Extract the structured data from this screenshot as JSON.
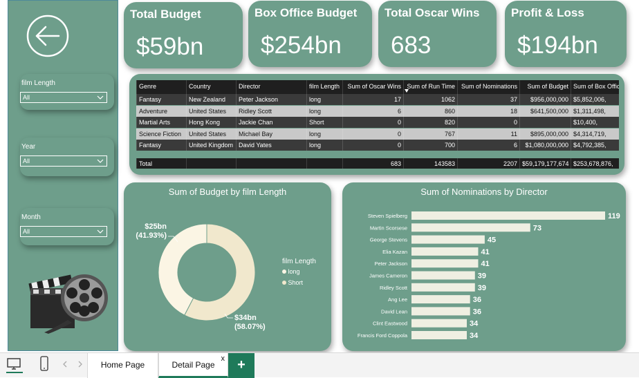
{
  "kpis": [
    {
      "title": "Total Budget",
      "value": "$59bn"
    },
    {
      "title": "Box Office Budget",
      "value": "$254bn"
    },
    {
      "title": "Total Oscar Wins",
      "value": "683"
    },
    {
      "title": "Profit & Loss",
      "value": "$194bn"
    }
  ],
  "slicers": [
    {
      "title": "film Length",
      "value": "All"
    },
    {
      "title": "Year",
      "value": "All"
    },
    {
      "title": "Month",
      "value": "All"
    }
  ],
  "table": {
    "headers": [
      "Genre",
      "Country",
      "Director",
      "film Length",
      "Sum of Oscar Wins",
      "Sum of Run Time",
      "Sum of Nominations",
      "Sum of Budget",
      "Sum of Box Office"
    ],
    "rows": [
      [
        "Fantasy",
        "New Zealand",
        "Peter Jackson",
        "long",
        "17",
        "1062",
        "37",
        "$956,000,000",
        "$5,852,006,"
      ],
      [
        "Adventure",
        "United States",
        "Ridley Scott",
        "long",
        "6",
        "860",
        "18",
        "$641,500,000",
        "$1,311,498,"
      ],
      [
        "Martial Arts",
        "Hong Kong",
        "Jackie Chan",
        "Short",
        "0",
        "820",
        "0",
        "",
        "$10,400,"
      ],
      [
        "Science Fiction",
        "United States",
        "Michael Bay",
        "long",
        "0",
        "767",
        "11",
        "$895,000,000",
        "$4,314,719,"
      ],
      [
        "Fantasy",
        "United Kingdom",
        "David Yates",
        "long",
        "0",
        "700",
        "6",
        "$1,080,000,000",
        "$4,792,385,"
      ]
    ],
    "total": [
      "Total",
      "",
      "",
      "",
      "683",
      "143583",
      "2207",
      "$59,179,177,674",
      "$253,678,876,"
    ]
  },
  "donut": {
    "title": "Sum of Budget by film Length",
    "legend_title": "film Length",
    "label_long_value": "$25bn",
    "label_long_pct": "(41.93%)",
    "label_short_value": "$34bn",
    "label_short_pct": "(58.07%)"
  },
  "bar_title": "Sum of Nominations by Director",
  "chart_data": [
    {
      "type": "pie",
      "title": "Sum of Budget by film Length",
      "categories": [
        "long",
        "Short"
      ],
      "values": [
        25,
        34
      ],
      "percent": [
        41.93,
        58.07
      ],
      "legend_title": "film Length",
      "colors": [
        "#fbf5e4",
        "#f1e8cd"
      ]
    },
    {
      "type": "bar",
      "title": "Sum of Nominations by Director",
      "orientation": "horizontal",
      "categories": [
        "Steven Spielberg",
        "Martin Scorsese",
        "George Stevens",
        "Elia Kazan",
        "Peter Jackson",
        "James Cameron",
        "Ridley Scott",
        "Ang Lee",
        "David Lean",
        "Clint Eastwood",
        "Francis Ford Coppola"
      ],
      "values": [
        119,
        73,
        45,
        41,
        41,
        39,
        39,
        36,
        36,
        34,
        34
      ],
      "bar_color": "#efefe2"
    }
  ],
  "tabs": [
    {
      "label": "Home Page"
    },
    {
      "label": "Detail Page"
    }
  ],
  "tab_close": "x",
  "add_tab": "+"
}
